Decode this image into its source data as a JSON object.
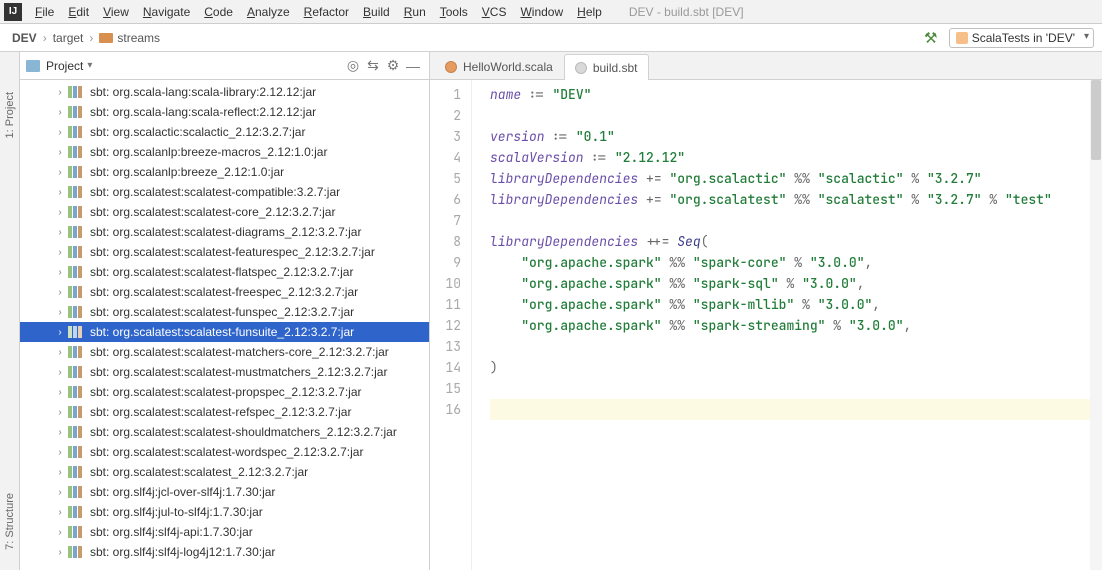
{
  "app_icon": "IJ",
  "menu": [
    "File",
    "Edit",
    "View",
    "Navigate",
    "Code",
    "Analyze",
    "Refactor",
    "Build",
    "Run",
    "Tools",
    "VCS",
    "Window",
    "Help"
  ],
  "window_title": "DEV - build.sbt [DEV]",
  "breadcrumbs": {
    "root": "DEV",
    "path": [
      "target",
      "streams"
    ]
  },
  "run_config": "ScalaTests in 'DEV'",
  "sidebar": {
    "title": "Project",
    "items": [
      "sbt: org.scala-lang:scala-library:2.12.12:jar",
      "sbt: org.scala-lang:scala-reflect:2.12.12:jar",
      "sbt: org.scalactic:scalactic_2.12:3.2.7:jar",
      "sbt: org.scalanlp:breeze-macros_2.12:1.0:jar",
      "sbt: org.scalanlp:breeze_2.12:1.0:jar",
      "sbt: org.scalatest:scalatest-compatible:3.2.7:jar",
      "sbt: org.scalatest:scalatest-core_2.12:3.2.7:jar",
      "sbt: org.scalatest:scalatest-diagrams_2.12:3.2.7:jar",
      "sbt: org.scalatest:scalatest-featurespec_2.12:3.2.7:jar",
      "sbt: org.scalatest:scalatest-flatspec_2.12:3.2.7:jar",
      "sbt: org.scalatest:scalatest-freespec_2.12:3.2.7:jar",
      "sbt: org.scalatest:scalatest-funspec_2.12:3.2.7:jar",
      "sbt: org.scalatest:scalatest-funsuite_2.12:3.2.7:jar",
      "sbt: org.scalatest:scalatest-matchers-core_2.12:3.2.7:jar",
      "sbt: org.scalatest:scalatest-mustmatchers_2.12:3.2.7:jar",
      "sbt: org.scalatest:scalatest-propspec_2.12:3.2.7:jar",
      "sbt: org.scalatest:scalatest-refspec_2.12:3.2.7:jar",
      "sbt: org.scalatest:scalatest-shouldmatchers_2.12:3.2.7:jar",
      "sbt: org.scalatest:scalatest-wordspec_2.12:3.2.7:jar",
      "sbt: org.scalatest:scalatest_2.12:3.2.7:jar",
      "sbt: org.slf4j:jcl-over-slf4j:1.7.30:jar",
      "sbt: org.slf4j:jul-to-slf4j:1.7.30:jar",
      "sbt: org.slf4j:slf4j-api:1.7.30:jar",
      "sbt: org.slf4j:slf4j-log4j12:1.7.30:jar"
    ],
    "selected_index": 12
  },
  "tabs": [
    {
      "label": "HelloWorld.scala",
      "kind": "scala",
      "active": false
    },
    {
      "label": "build.sbt",
      "kind": "sbt",
      "active": true
    }
  ],
  "gutter_lines": [
    "1",
    "2",
    "3",
    "4",
    "5",
    "6",
    "7",
    "8",
    "9",
    "10",
    "11",
    "12",
    "13",
    "14",
    "15",
    "16"
  ],
  "code": {
    "l1": {
      "key": "name",
      "op": ":=",
      "str": "\"DEV\""
    },
    "l3": {
      "key": "version",
      "op": ":=",
      "str": "\"0.1\""
    },
    "l4": {
      "key": "scalaVersion",
      "op": ":=",
      "str": "\"2.12.12\""
    },
    "l5": {
      "key": "libraryDependencies",
      "op": "+=",
      "g": "\"org.scalactic\"",
      "a": "\"scalactic\"",
      "v": "\"3.2.7\""
    },
    "l6": {
      "key": "libraryDependencies",
      "op": "+=",
      "g": "\"org.scalatest\"",
      "a": "\"scalatest\"",
      "v": "\"3.2.7\"",
      "scope": "\"test\""
    },
    "l8": {
      "key": "libraryDependencies",
      "op": "++=",
      "seq": "Seq"
    },
    "l9": {
      "g": "\"org.apache.spark\"",
      "a": "\"spark-core\"",
      "v": "\"3.0.0\""
    },
    "l10": {
      "g": "\"org.apache.spark\"",
      "a": "\"spark-sql\"",
      "v": "\"3.0.0\""
    },
    "l11": {
      "g": "\"org.apache.spark\"",
      "a": "\"spark-mllib\"",
      "v": "\"3.0.0\""
    },
    "l12": {
      "g": "\"org.apache.spark\"",
      "a": "\"spark-streaming\"",
      "v": "\"3.0.0\""
    },
    "l14": {
      "close": ")"
    }
  },
  "leftstrip": {
    "project": "1: Project",
    "structure": "7: Structure"
  }
}
